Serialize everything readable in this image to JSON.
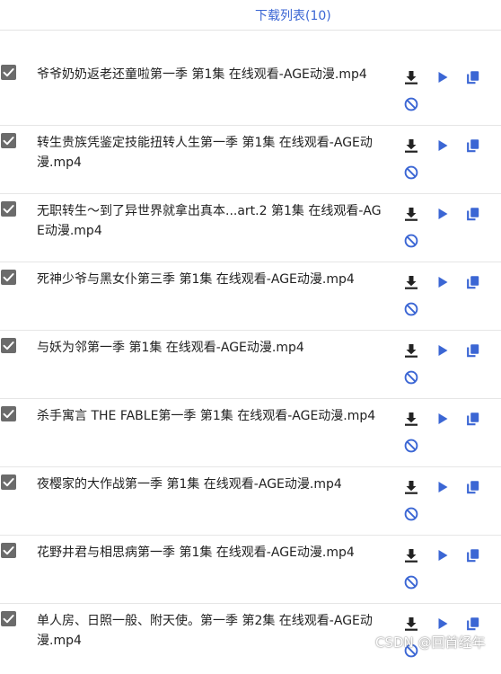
{
  "header": {
    "title": "下载列表(10)"
  },
  "colors": {
    "accent": "#3b66d4",
    "download_icon": "#222222",
    "checkbox": "#6b6b6b",
    "block_icon": "#3b66d4"
  },
  "items": [
    {
      "checked": true,
      "filename": "爷爷奶奶返老还童啦第一季 第1集 在线观看-AGE动漫.mp4"
    },
    {
      "checked": true,
      "filename": "转生贵族凭鉴定技能扭转人生第一季 第1集 在线观看-AGE动漫.mp4"
    },
    {
      "checked": true,
      "filename": "无职转生～到了异世界就拿出真本...art.2 第1集 在线观看-AGE动漫.mp4"
    },
    {
      "checked": true,
      "filename": "死神少爷与黑女仆第三季 第1集 在线观看-AGE动漫.mp4"
    },
    {
      "checked": true,
      "filename": "与妖为邻第一季 第1集 在线观看-AGE动漫.mp4"
    },
    {
      "checked": true,
      "filename": "杀手寓言 THE FABLE第一季 第1集 在线观看-AGE动漫.mp4"
    },
    {
      "checked": true,
      "filename": "夜樱家的大作战第一季 第1集 在线观看-AGE动漫.mp4"
    },
    {
      "checked": true,
      "filename": "花野井君与相思病第一季 第1集 在线观看-AGE动漫.mp4"
    },
    {
      "checked": true,
      "filename": "单人房、日照一般、附天使。第一季 第2集 在线观看-AGE动漫.mp4"
    }
  ],
  "icons": {
    "download": "download-icon",
    "play": "play-icon",
    "copy": "copy-icon",
    "block": "block-icon",
    "checkbox": "checkbox-checked-icon"
  },
  "watermark": "CSDN @回首经年"
}
